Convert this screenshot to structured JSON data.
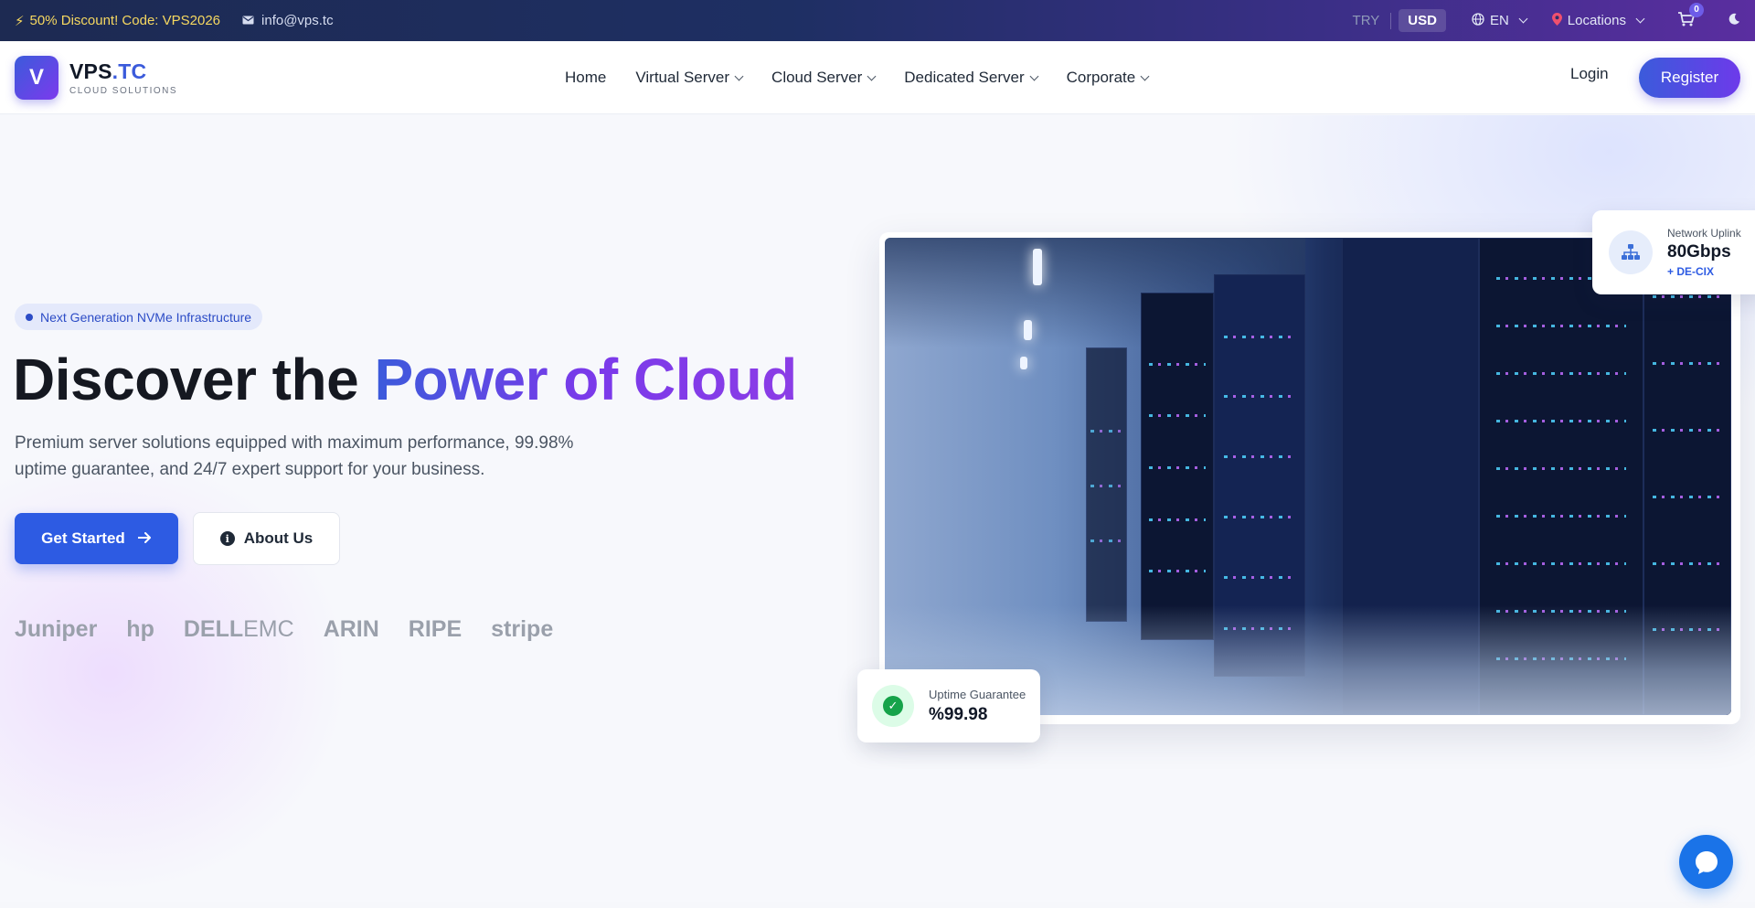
{
  "topbar": {
    "promo": "50% Discount! Code: VPS2026",
    "email": "info@vps.tc",
    "currencies": [
      "TRY",
      "USD"
    ],
    "active_currency": "USD",
    "language": "EN",
    "locations": "Locations",
    "cart_count": "0"
  },
  "nav": {
    "brand_main": "VPS",
    "brand_tld": ".TC",
    "brand_sub": "CLOUD SOLUTIONS",
    "logo_letter": "V",
    "items": [
      {
        "label": "Home"
      },
      {
        "label": "Virtual Server"
      },
      {
        "label": "Cloud Server"
      },
      {
        "label": "Dedicated Server"
      },
      {
        "label": "Corporate"
      }
    ],
    "login": "Login",
    "register": "Register"
  },
  "hero": {
    "pill": "Next Generation NVMe Infrastructure",
    "title_plain": "Discover the ",
    "title_accent": "Power of Cloud",
    "subtitle": "Premium server solutions equipped with maximum performance, 99.98% uptime guarantee, and 24/7 expert support for your business.",
    "cta_primary": "Get Started",
    "cta_secondary": "About Us",
    "partners": [
      "Juniper",
      "hp",
      "DELL",
      "EMC",
      "ARIN",
      "RIPE",
      "stripe"
    ]
  },
  "cards": {
    "uplink_label": "Network Uplink",
    "uplink_value": "80Gbps",
    "uplink_sub": "+ DE-CIX",
    "uptime_label": "Uptime Guarantee",
    "uptime_value": "%99.98"
  },
  "colors": {
    "primary": "#2d5be3",
    "accent": "#7a3aea",
    "promo": "#f6d860",
    "success": "#16a34a"
  }
}
